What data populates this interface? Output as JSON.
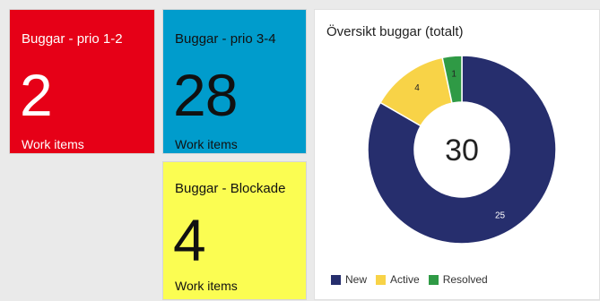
{
  "tiles": {
    "prio12": {
      "title": "Buggar - prio 1-2",
      "count": "2",
      "subtitle": "Work items",
      "color": "#e60017"
    },
    "prio34": {
      "title": "Buggar - prio 3-4",
      "count": "28",
      "subtitle": "Work items",
      "color": "#009ccc"
    },
    "blocked": {
      "title": "Buggar - Blockade",
      "count": "4",
      "subtitle": "Work items",
      "color": "#fbfd52"
    }
  },
  "chart_data": {
    "type": "pie",
    "title": "Översikt buggar (totalt)",
    "total_label": "30",
    "categories": [
      "New",
      "Active",
      "Resolved"
    ],
    "values": [
      25,
      4,
      1
    ],
    "colors": [
      "#262e6d",
      "#f8d347",
      "#2f9a45"
    ],
    "legend_position": "bottom-left"
  }
}
